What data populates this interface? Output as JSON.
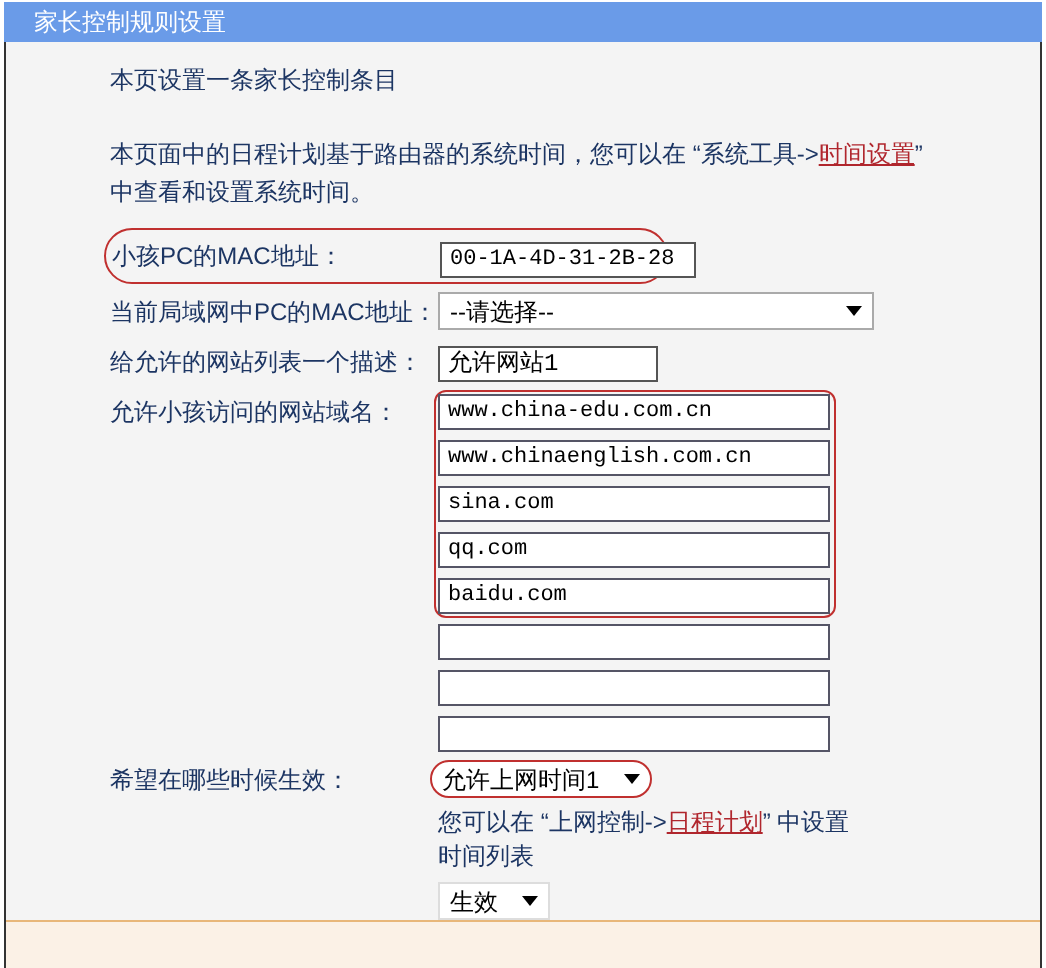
{
  "window": {
    "title": "家长控制规则设置"
  },
  "intro": "本页设置一条家长控制条目",
  "notice": {
    "before": "本页面中的日程计划基于路由器的系统时间，您可以在 “系统工具->",
    "link": "时间设置",
    "after": "” 中查看和设置系统时间。"
  },
  "fields": [
    {
      "kind": "text",
      "label": "小孩PC的MAC地址：",
      "value": "00-1A-4D-31-2B-28",
      "highlighted": true
    },
    {
      "kind": "wide-dropdown",
      "label": "当前局域网中PC的MAC地址：",
      "value": "--请选择--",
      "highlighted": false
    },
    {
      "kind": "short-text",
      "label": "给允许的网站列表一个描述：",
      "value": "允许网站1",
      "highlighted": false
    },
    {
      "kind": "list",
      "label": "允许小孩访问的网站域名：",
      "groups": [
        {
          "highlighted": true,
          "items": [
            {
              "kind": "filled",
              "value": "www.china-edu.com.cn"
            },
            {
              "kind": "filled",
              "value": "www.chinaenglish.com.cn"
            },
            {
              "kind": "filled",
              "value": "sina.com"
            },
            {
              "kind": "filled",
              "value": "qq.com"
            },
            {
              "kind": "filled",
              "value": "baidu.com"
            }
          ]
        },
        {
          "highlighted": false,
          "items": [
            {
              "kind": "blank"
            },
            {
              "kind": "blank"
            },
            {
              "kind": "blank"
            }
          ]
        }
      ]
    },
    {
      "kind": "dropdown",
      "label": "希望在哪些时候生效：",
      "value": "允许上网时间1",
      "highlighted": true,
      "note": {
        "before": "您可以在 “上网控制->",
        "link": "日程计划",
        "after": "” 中设置时间列表"
      }
    },
    {
      "kind": "dropdown",
      "value": "生效",
      "highlighted": false
    }
  ]
}
